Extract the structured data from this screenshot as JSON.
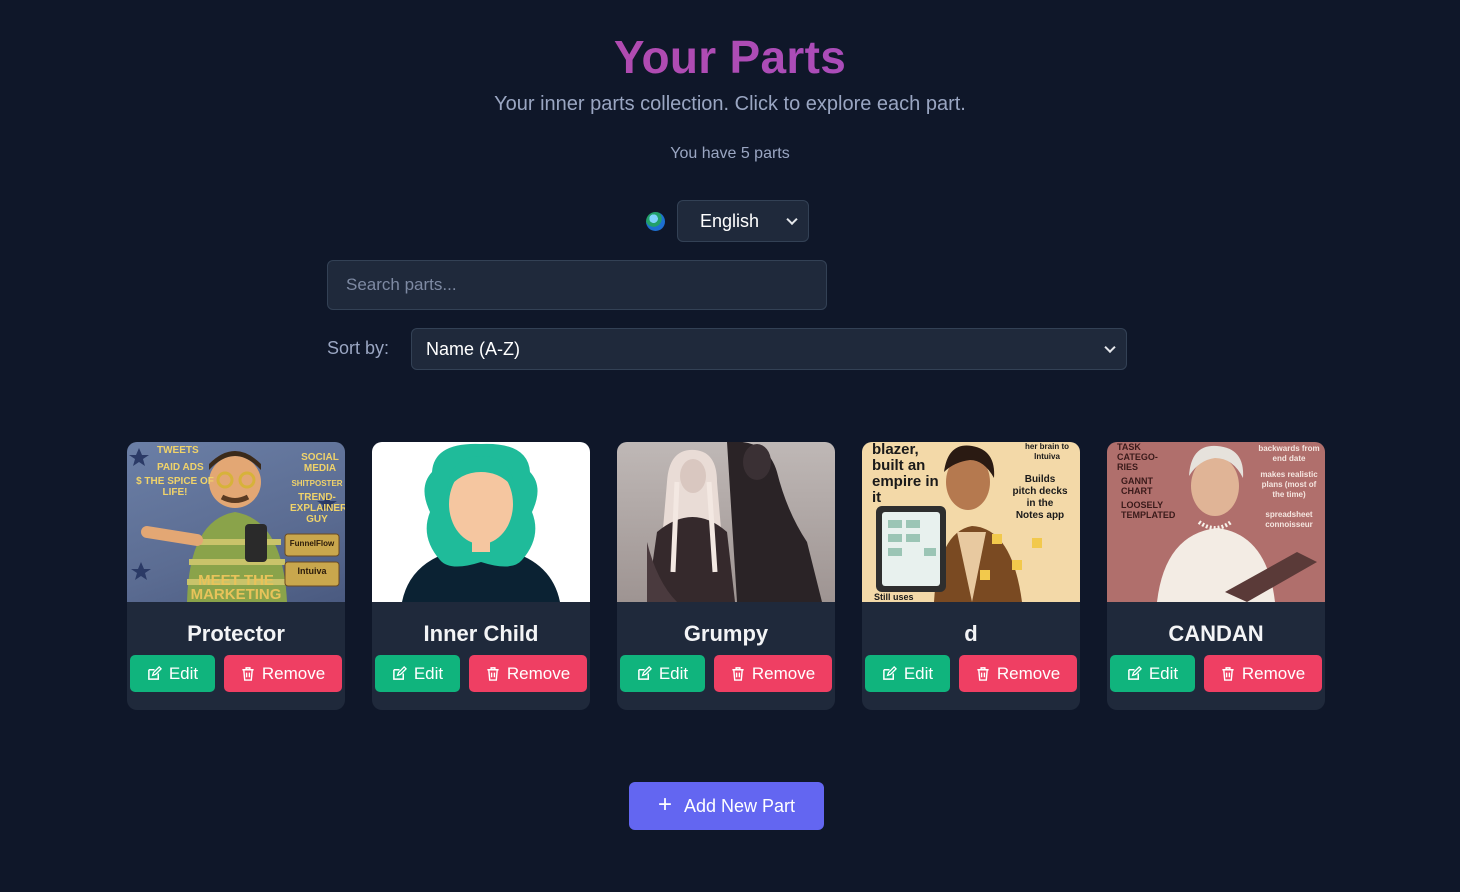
{
  "header": {
    "title": "Your Parts",
    "subtitle": "Your inner parts collection. Click to explore each part.",
    "count_text": "You have 5 parts"
  },
  "language": {
    "selected": "English"
  },
  "search": {
    "placeholder": "Search parts..."
  },
  "sort": {
    "label": "Sort by:",
    "selected": "Name (A-Z)"
  },
  "parts": [
    {
      "name": "Protector",
      "edit_label": "Edit",
      "remove_label": "Remove",
      "thumb_text": [
        "TWEETS",
        "PAID ADS",
        "$ THE SPICE OF LIFE!",
        "SOCIAL MEDIA",
        "SHITPOSTER",
        "TREND-EXPLAINER GUY",
        "FunnelFlow",
        "Intuiva",
        "MEET THE MARKETING"
      ]
    },
    {
      "name": "Inner Child",
      "edit_label": "Edit",
      "remove_label": "Remove"
    },
    {
      "name": "Grumpy",
      "edit_label": "Edit",
      "remove_label": "Remove"
    },
    {
      "name": "d",
      "edit_label": "Edit",
      "remove_label": "Remove",
      "thumb_text": [
        "blazer, built an empire in it",
        "her brain to Intuiva",
        "Builds pitch decks in the Notes app",
        "Still uses"
      ]
    },
    {
      "name": "CANDAN",
      "edit_label": "Edit",
      "remove_label": "Remove",
      "thumb_text": [
        "TASK CATEGO-RIES",
        "GANNT CHART",
        "LOOSELY TEMPLATED",
        "backwards from end date",
        "makes realistic plans (most of the time)",
        "spreadsheet connoisseur"
      ]
    }
  ],
  "add_button": {
    "label": "Add New Part"
  },
  "colors": {
    "background": "#0f1729",
    "card": "#1f293b",
    "edit": "#10b47d",
    "remove": "#ef3f63",
    "primary": "#6366f1",
    "title_gradient_start": "#c0489a",
    "title_gradient_end": "#9b4fd0"
  },
  "icons": [
    "globe-icon",
    "chevron-down-icon",
    "edit-icon",
    "trash-icon",
    "plus-icon"
  ]
}
